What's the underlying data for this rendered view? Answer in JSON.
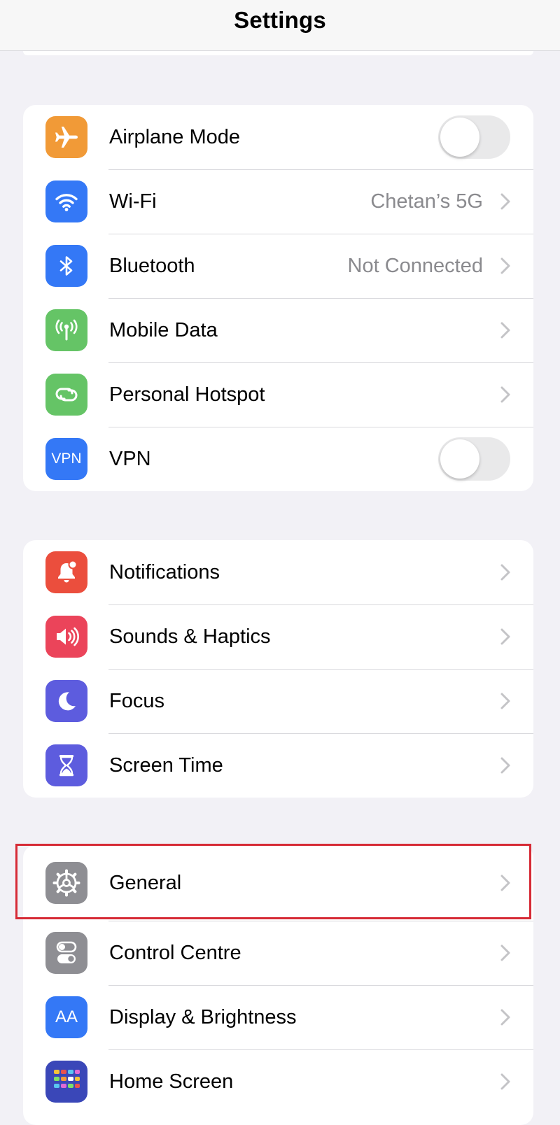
{
  "header": {
    "title": "Settings"
  },
  "groups": [
    {
      "rows": [
        {
          "label": "Airplane Mode",
          "icon": "airplane-icon",
          "icon_color": "#f19a37",
          "control": "toggle",
          "toggle_on": false
        },
        {
          "label": "Wi-Fi",
          "icon": "wifi-icon",
          "icon_color": "#3478f6",
          "value": "Chetan’s 5G",
          "control": "chevron"
        },
        {
          "label": "Bluetooth",
          "icon": "bluetooth-icon",
          "icon_color": "#3478f6",
          "value": "Not Connected",
          "control": "chevron"
        },
        {
          "label": "Mobile Data",
          "icon": "antenna-icon",
          "icon_color": "#65c466",
          "control": "chevron"
        },
        {
          "label": "Personal Hotspot",
          "icon": "hotspot-icon",
          "icon_color": "#65c466",
          "control": "chevron"
        },
        {
          "label": "VPN",
          "icon": "vpn-icon",
          "icon_text": "VPN",
          "icon_color": "#3478f6",
          "control": "toggle",
          "toggle_on": false
        }
      ]
    },
    {
      "rows": [
        {
          "label": "Notifications",
          "icon": "bell-icon",
          "icon_color": "#eb4e3d",
          "control": "chevron"
        },
        {
          "label": "Sounds & Haptics",
          "icon": "speaker-icon",
          "icon_color": "#eb445a",
          "control": "chevron"
        },
        {
          "label": "Focus",
          "icon": "moon-icon",
          "icon_color": "#5d5cde",
          "control": "chevron"
        },
        {
          "label": "Screen Time",
          "icon": "hourglass-icon",
          "icon_color": "#5d5cde",
          "control": "chevron"
        }
      ]
    },
    {
      "rows": [
        {
          "label": "General",
          "icon": "gear-icon",
          "icon_color": "#8e8e93",
          "control": "chevron",
          "highlighted": true
        },
        {
          "label": "Control Centre",
          "icon": "switches-icon",
          "icon_color": "#8e8e93",
          "control": "chevron"
        },
        {
          "label": "Display & Brightness",
          "icon": "text-size-icon",
          "icon_text": "AA",
          "icon_color": "#3478f6",
          "control": "chevron"
        },
        {
          "label": "Home Screen",
          "icon": "app-grid-icon",
          "icon_color": "#3a47b8",
          "control": "chevron"
        }
      ]
    }
  ],
  "colors": {
    "background": "#f2f1f6",
    "card": "#ffffff",
    "secondary_text": "#8a8a8e",
    "chevron": "#c4c4c7",
    "highlight_border": "#d62a35",
    "toggle_off_track": "#e9e9ea"
  }
}
